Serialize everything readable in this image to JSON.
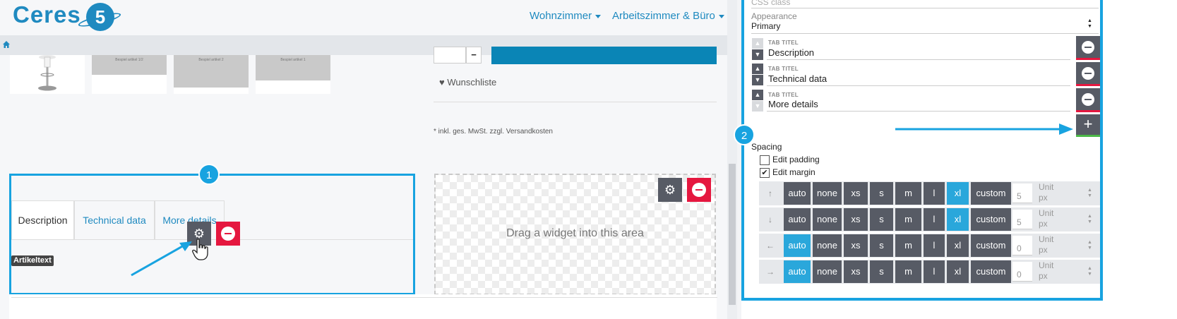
{
  "header": {
    "logo_text": "Ceres",
    "logo_badge": "5",
    "nav": [
      {
        "label": "Wohnzimmer"
      },
      {
        "label": "Arbeitszimmer & Büro"
      }
    ]
  },
  "product": {
    "thumb_captions": [
      "Bespiel artikel 1/2",
      "Bespiel artikel 2",
      "Bespiel artikel 1"
    ],
    "qty_minus": "−",
    "wishlist": "Wunschliste",
    "tax_note": "* inkl. ges. MwSt. zzgl. Versandkosten"
  },
  "tabs_widget": {
    "badge": "1",
    "tabs": [
      {
        "label": "Description"
      },
      {
        "label": "Technical data"
      },
      {
        "label": "More details"
      }
    ],
    "artikel_label": "Artikeltext"
  },
  "dropzone": {
    "text": "Drag a widget into this area"
  },
  "panel": {
    "css_class_label": "CSS class",
    "appearance_label": "Appearance",
    "appearance_value": "Primary",
    "tab_title_label": "TAB TITEL",
    "tab_titles": [
      "Description",
      "Technical data",
      "More details"
    ],
    "badge2": "2",
    "add_symbol": "+",
    "spacing_label": "Spacing",
    "edit_padding": "Edit padding",
    "edit_margin": "Edit margin",
    "spacing_options": [
      "auto",
      "none",
      "xs",
      "s",
      "m",
      "l",
      "xl",
      "custom"
    ],
    "unit_label": "Unit",
    "unit_value": "px",
    "rows": [
      {
        "arrow": "↑",
        "selected": "xl",
        "value": "5"
      },
      {
        "arrow": "↓",
        "selected": "xl",
        "value": "5"
      },
      {
        "arrow": "←",
        "selected": "auto",
        "value": "0"
      },
      {
        "arrow": "→",
        "selected": "auto",
        "value": "0"
      }
    ]
  },
  "colors": {
    "accent": "#18a3e0",
    "brand": "#1f8ac0",
    "danger": "#e5173f",
    "success": "#4cb848",
    "button": "#575b65"
  }
}
